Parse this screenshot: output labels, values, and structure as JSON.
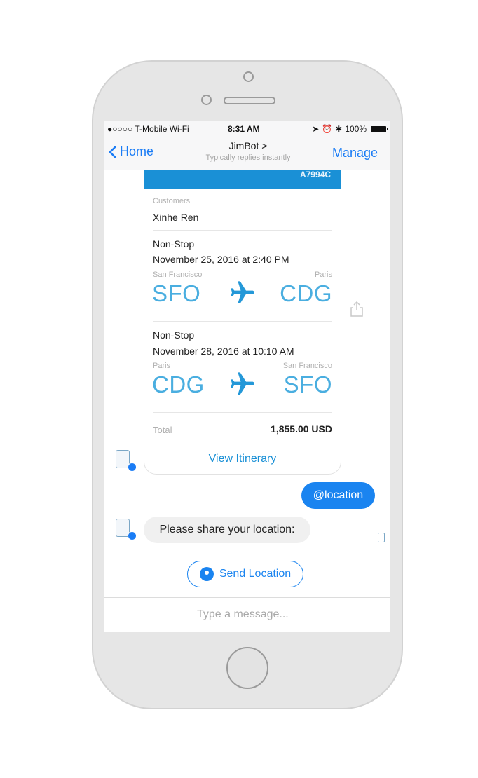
{
  "status_bar": {
    "carrier": "●○○○○ T-Mobile Wi-Fi",
    "time": "8:31 AM",
    "battery": "100%"
  },
  "nav": {
    "back_label": "Home",
    "title": "JimBot >",
    "subtitle": "Typically replies instantly",
    "manage_label": "Manage"
  },
  "receipt": {
    "confirmation_code": "A7994C",
    "customers_label": "Customers",
    "customer_name": "Xinhe Ren",
    "legs": [
      {
        "type": "Non-Stop",
        "datetime": "November 25, 2016 at 2:40 PM",
        "from_city": "San Francisco",
        "to_city": "Paris",
        "from_code": "SFO",
        "to_code": "CDG"
      },
      {
        "type": "Non-Stop",
        "datetime": "November 28, 2016 at 10:10 AM",
        "from_city": "Paris",
        "to_city": "San Francisco",
        "from_code": "CDG",
        "to_code": "SFO"
      }
    ],
    "total_label": "Total",
    "total_value": "1,855.00 USD",
    "view_button": "View Itinerary"
  },
  "messages": {
    "user_message": "@location",
    "bot_message": "Please share your location:"
  },
  "quick_reply": {
    "label": "Send Location"
  },
  "composer": {
    "placeholder": "Type a message..."
  },
  "colors": {
    "accent": "#1a84f0",
    "card_header": "#1a90d6",
    "airport_code": "#4aaee0"
  }
}
